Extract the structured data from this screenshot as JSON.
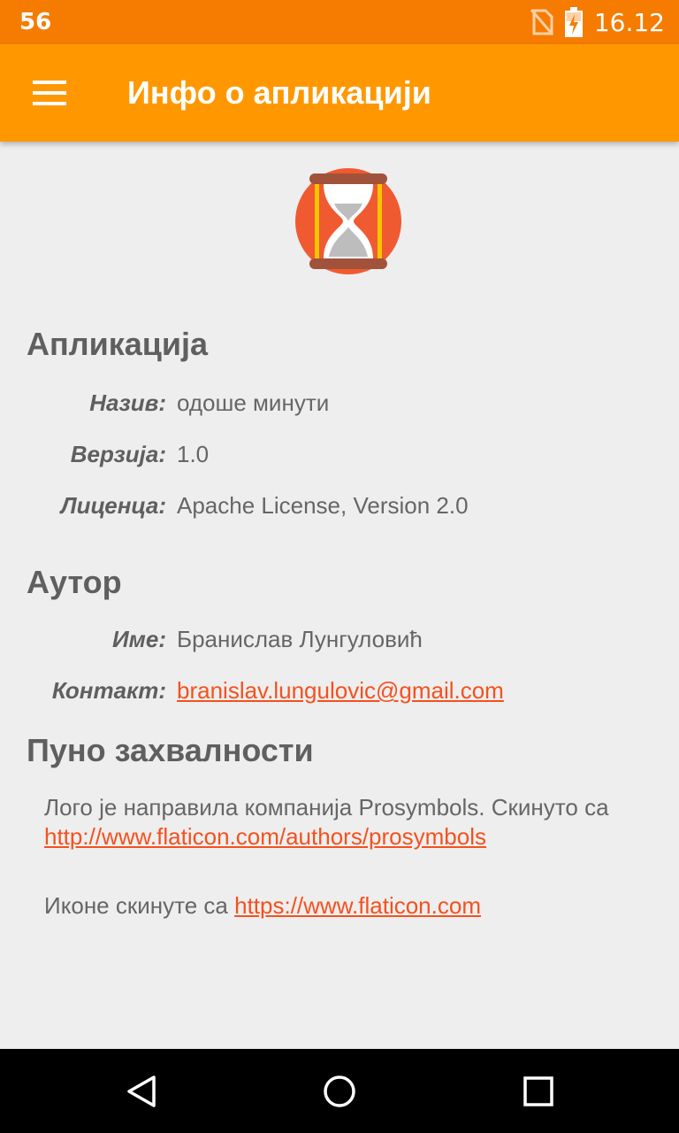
{
  "status_bar": {
    "left_text": "56",
    "time": "16.12",
    "icons": [
      "no-sim-icon",
      "battery-charging-icon"
    ]
  },
  "app_bar": {
    "menu_icon": "hamburger-menu-icon",
    "title": "Инфо о апликацији"
  },
  "logo": {
    "icon": "hourglass-logo-icon"
  },
  "app_section": {
    "title": "Апликација",
    "rows": [
      {
        "label": "Назив:",
        "value": "одоше минути"
      },
      {
        "label": "Верзија:",
        "value": "1.0"
      },
      {
        "label": "Лиценца:",
        "value": "Apache License, Version 2.0"
      }
    ]
  },
  "author_section": {
    "title": "Аутор",
    "rows": [
      {
        "label": "Име:",
        "value": "Бранислав Лунгуловић"
      },
      {
        "label": "Контакт:",
        "value": "branislav.lungulovic@gmail.com"
      }
    ]
  },
  "thanks_section": {
    "title": "Пуно захвалности",
    "logo_credit_text": "Лого је направила компанија Prosymbols. Скинуто са ",
    "logo_credit_link": "http://www.flaticon.com/authors/prosymbols",
    "icons_credit_text": "Иконе скинуте са ",
    "icons_credit_link": "https://www.flaticon.com"
  },
  "colors": {
    "status_bar": "#f57c00",
    "app_bar": "#ff9800",
    "link": "#f4511e",
    "background": "#eeeeee"
  },
  "nav_bar": {
    "icons": [
      "back-icon",
      "home-icon",
      "recents-icon"
    ]
  }
}
